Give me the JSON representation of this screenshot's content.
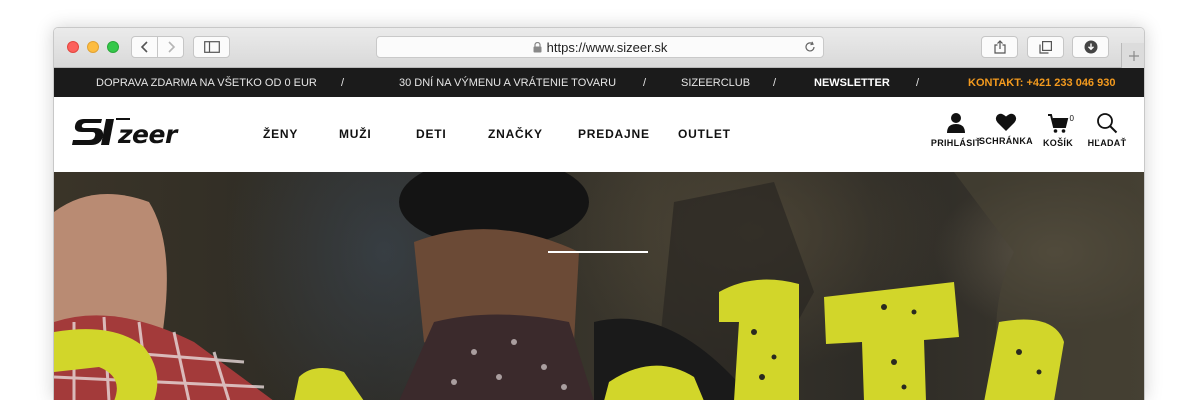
{
  "browser": {
    "url": "https://www.sizeer.sk"
  },
  "infobar": {
    "shipping": "DOPRAVA ZDARMA NA VŠETKO OD 0 EUR",
    "returns": "30 DNÍ NA VÝMENU A VRÁTENIE TOVARU",
    "club": "SIZEERCLUB",
    "newsletter": "NEWSLETTER",
    "contact": "KONTAKT: +421 233 046 930",
    "separator": "/"
  },
  "logo": {
    "text": "zeer"
  },
  "nav": {
    "items": [
      "ŽENY",
      "MUŽI",
      "DETI",
      "ZNAČKY",
      "PREDAJNE",
      "OUTLET"
    ]
  },
  "header_actions": {
    "login": "PRIHLÁSIŤ",
    "wishlist": "SCHRÁNKA",
    "cart": "KOŠÍK",
    "cart_count": "0",
    "search": "HĽADAŤ"
  },
  "colors": {
    "infobar_bg": "#1b1b1b",
    "contact_accent": "#f39a1e",
    "hero_accent": "#d2d62a"
  }
}
